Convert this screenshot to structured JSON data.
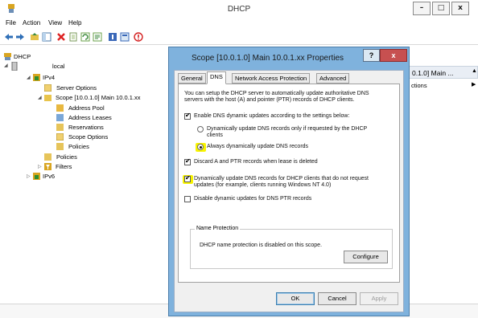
{
  "window": {
    "title": "DHCP",
    "minimize": "–",
    "maximize": "□",
    "close": "x"
  },
  "menu": [
    "File",
    "Action",
    "View",
    "Help"
  ],
  "toolbar_icons": [
    "back-icon",
    "forward-icon",
    "folder-up-icon",
    "show-hide-tree-icon",
    "delete-icon",
    "export-icon",
    "refresh-icon",
    "properties-icon",
    "help-icon",
    "view-icon",
    "stop-icon"
  ],
  "tree": {
    "root": "DHCP",
    "server": "local",
    "ipv4": "IPv4",
    "server_options": "Server Options",
    "scope": "Scope [10.0.1.0] Main 10.0.1.xx",
    "address_pool": "Address Pool",
    "address_leases": "Address Leases",
    "reservations": "Reservations",
    "scope_options": "Scope Options",
    "scope_policies": "Policies",
    "ipv4_policies": "Policies",
    "filters": "Filters",
    "ipv6": "IPv6"
  },
  "right_pane": {
    "header": "0.1.0] Main ...",
    "actions": "ctions"
  },
  "dialog": {
    "title": "Scope [10.0.1.0] Main 10.0.1.xx Properties",
    "help": "?",
    "close": "x",
    "tabs": [
      "General",
      "DNS",
      "Network Access Protection",
      "Advanced"
    ],
    "active_tab": "DNS",
    "intro_line1": "You can setup the DHCP server to automatically update authoritative DNS",
    "intro_line2": "servers with the host (A) and pointer (PTR) records of DHCP clients.",
    "enable_dns": "Enable DNS dynamic updates according to the settings below:",
    "radio_requested_line1": "Dynamically update DNS records only if requested by the DHCP",
    "radio_requested_line2": "clients",
    "radio_always": "Always dynamically update DNS records",
    "discard": "Discard A and PTR records when lease is deleted",
    "dynamic_line1": "Dynamically update DNS records for DHCP clients that do not request",
    "dynamic_line2": "updates (for example, clients running Windows NT 4.0)",
    "disable_ptr": "Disable dynamic updates for DNS PTR records",
    "name_protection_title": "Name Protection",
    "name_protection_text": "DHCP name protection is disabled on this scope.",
    "configure": "Configure",
    "ok": "OK",
    "cancel": "Cancel",
    "apply": "Apply"
  },
  "colors": {
    "dialog_frame": "#7fb2dd",
    "highlight": "#f7f300",
    "close_red": "#c75050"
  }
}
